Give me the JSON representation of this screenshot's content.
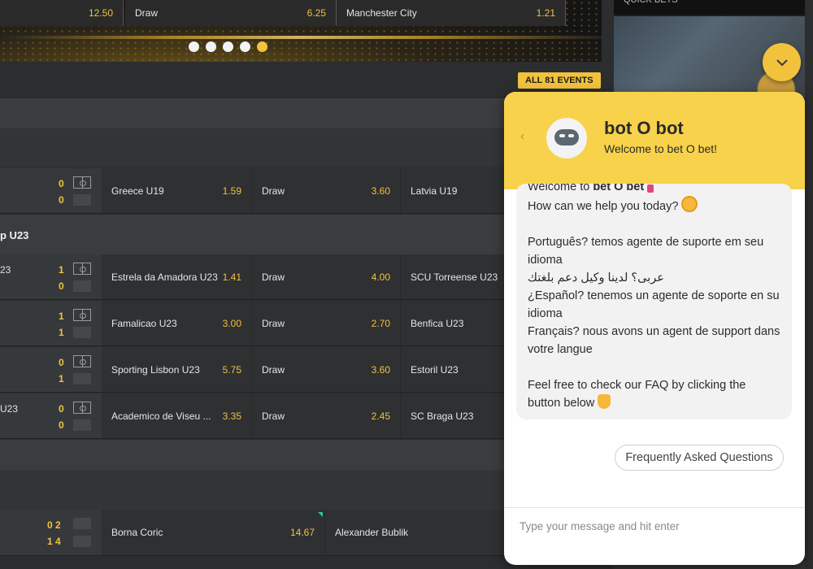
{
  "banner": {
    "strip": [
      {
        "team": "",
        "odds": "12.50"
      },
      {
        "team": "Draw",
        "odds": "6.25"
      },
      {
        "team": "Manchester City",
        "odds": "1.21"
      }
    ],
    "slides": 5,
    "active_slide": 5
  },
  "quick_bets": {
    "title": "QUICK BETS"
  },
  "all_events": "ALL 81 EVENTS",
  "leagues": [
    {
      "name": "p U23"
    }
  ],
  "matches": [
    {
      "league_label": "",
      "score1": "0",
      "score2": "0",
      "home": "Greece U19",
      "home_odds": "1.59",
      "draw": "Draw",
      "draw_odds": "3.60",
      "away": "Latvia U19"
    },
    {
      "league_label": "23",
      "score1": "1",
      "score2": "0",
      "home": "Estrela da Amadora U23",
      "home_odds": "1.41",
      "draw": "Draw",
      "draw_odds": "4.00",
      "away": "SCU Torreense U23"
    },
    {
      "league_label": "",
      "score1": "1",
      "score2": "1",
      "home": "Famalicao U23",
      "home_odds": "3.00",
      "draw": "Draw",
      "draw_odds": "2.70",
      "away": "Benfica U23"
    },
    {
      "league_label": "",
      "score1": "0",
      "score2": "1",
      "home": "Sporting Lisbon U23",
      "home_odds": "5.75",
      "draw": "Draw",
      "draw_odds": "3.60",
      "away": "Estoril U23"
    },
    {
      "league_label": "U23",
      "score1": "0",
      "score2": "0",
      "home": "Academico de Viseu ...",
      "home_odds": "3.35",
      "draw": "Draw",
      "draw_odds": "2.45",
      "away": "SC Braga U23"
    }
  ],
  "tennis": {
    "score1": "0 2",
    "score2": "1 4",
    "home": "Borna Coric",
    "home_odds": "14.67",
    "away": "Alexander Bublik"
  },
  "chat": {
    "bot_name": "bot O bot",
    "subtitle": "Welcome to bet O bet!",
    "welcome_prefix": "Welcome to ",
    "welcome_bold": "bet O bet",
    "help": "How can we help you today?",
    "pt": "Português? temos agente de suporte em seu idioma",
    "ar": "عربى؟ لدينا وكيل دعم بلغتك",
    "es": "¿Español? tenemos un agente de soporte en su idioma",
    "fr": "Français? nous avons un agent de support dans votre langue",
    "faq_text": "Feel free to check our FAQ by clicking the button below",
    "faq_button": "Frequently Asked Questions",
    "input_placeholder": "Type your message and hit enter"
  },
  "colors": {
    "accent": "#f2c23c",
    "chat_header": "#f8d24a"
  }
}
